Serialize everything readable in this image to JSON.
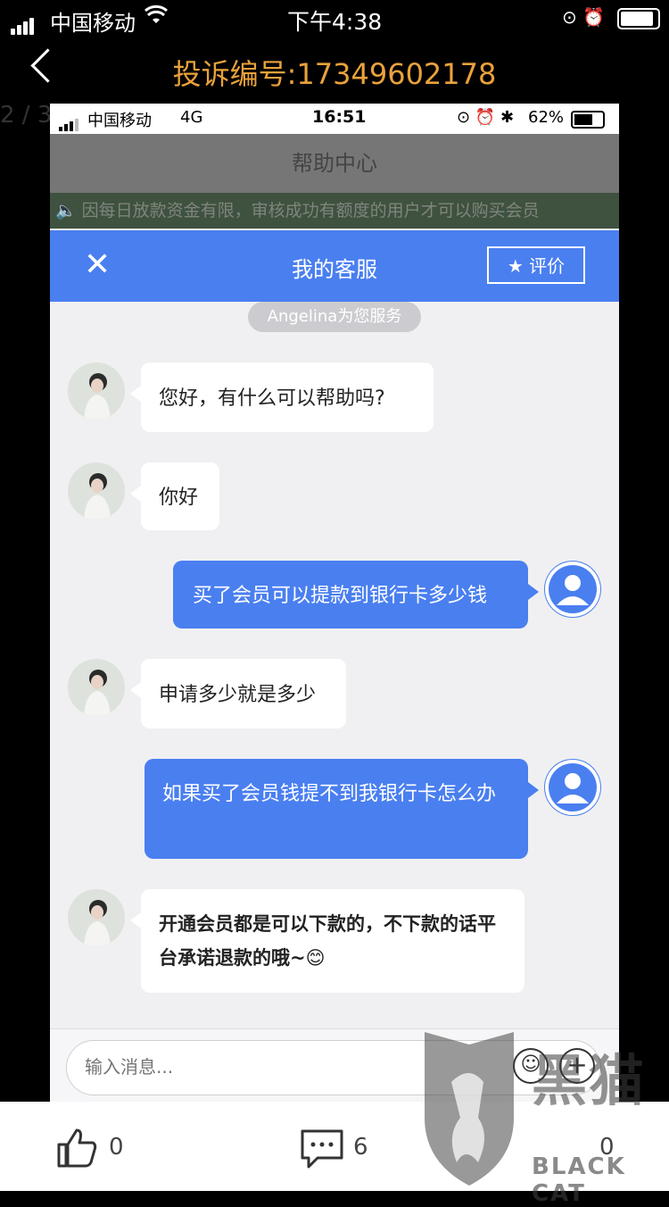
{
  "outer_status": {
    "carrier": "中国移动",
    "time": "下午4:38"
  },
  "title": "投诉编号:17349602178",
  "pager": "2 / 3",
  "inner_status": {
    "carrier": "中国移动",
    "network": "4G",
    "time": "16:51",
    "battery": "62%"
  },
  "help_center": "帮助中心",
  "notice": "因每日放款资金有限，审核成功有额度的用户才可以购买会员",
  "chat": {
    "title": "我的客服",
    "rate_label": "评价",
    "service_tag": "Angelina为您服务",
    "messages": [
      {
        "from": "agent",
        "text": "您好，有什么可以帮助吗?"
      },
      {
        "from": "agent",
        "text": "你好"
      },
      {
        "from": "user",
        "text": "买了会员可以提款到银行卡多少钱"
      },
      {
        "from": "agent",
        "text": "申请多少就是多少"
      },
      {
        "from": "user",
        "text": "如果买了会员钱提不到我银行卡怎么办"
      },
      {
        "from": "agent",
        "text": "开通会员都是可以下款的，不下款的话平台承诺退款的哦~",
        "emoji": "😊"
      }
    ],
    "input_placeholder": "输入消息..."
  },
  "bottom": {
    "likes": "0",
    "comments": "6",
    "shares": "0"
  },
  "watermark": {
    "text": "黑猫",
    "brand": "BLACK CAT"
  },
  "colors": {
    "accent": "#4a7ff0",
    "title": "#e9a23b"
  }
}
